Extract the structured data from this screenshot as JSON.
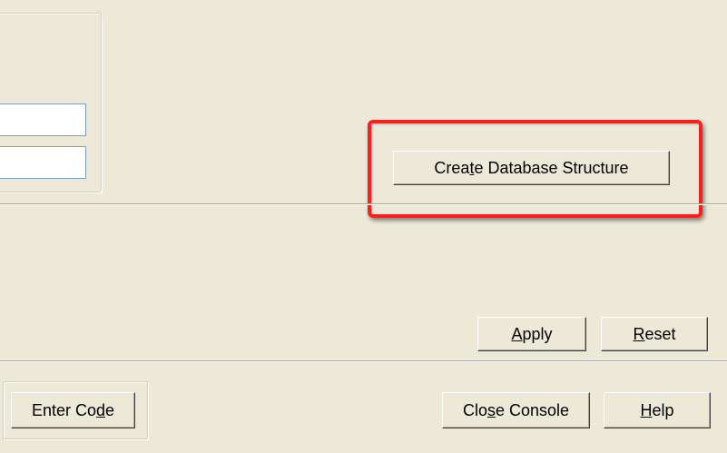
{
  "panel": {
    "field1_value": "",
    "field2_value": ""
  },
  "buttons": {
    "create_db": {
      "pre": "Crea",
      "accel": "t",
      "post": "e Database Structure"
    },
    "apply": {
      "pre": "",
      "accel": "A",
      "post": "pply"
    },
    "reset": {
      "pre": "",
      "accel": "R",
      "post": "eset"
    },
    "enter_code": {
      "pre": "Enter Co",
      "accel": "d",
      "post": "e"
    },
    "close_console": {
      "pre": "Clo",
      "accel": "s",
      "post": "e Console"
    },
    "help": {
      "pre": "",
      "accel": "H",
      "post": "elp"
    }
  },
  "annotation": {
    "highlight_color": "#FF1E1E"
  },
  "theme": {
    "window_bg": "#ECE9D8",
    "field_border": "#7F9DB9"
  }
}
